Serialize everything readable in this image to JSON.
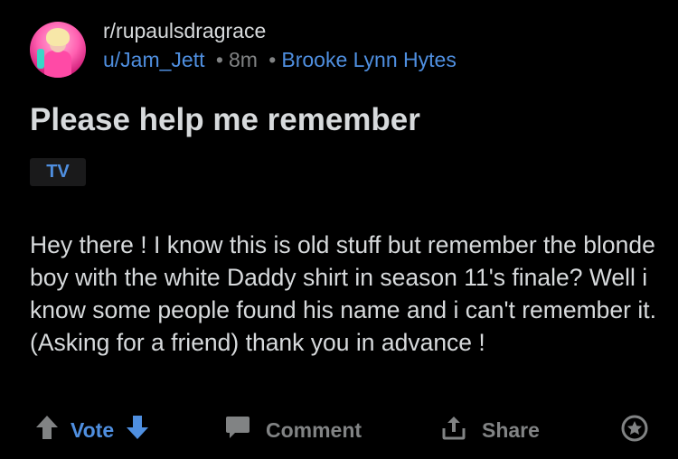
{
  "post": {
    "subreddit": "r/rupaulsdragrace",
    "author": "u/Jam_Jett",
    "separator": "•",
    "age": "8m",
    "user_flair": "Brooke Lynn Hytes",
    "title": "Please help me remember",
    "post_flair": "TV",
    "body": "Hey there ! I know this is old stuff but remember the blonde boy with the white Daddy shirt in season 11's finale? Well i know some people found his name and i can't remember it. (Asking for a friend) thank you in advance !"
  },
  "actions": {
    "vote_label": "Vote",
    "comment_label": "Comment",
    "share_label": "Share"
  },
  "colors": {
    "background": "#000000",
    "text": "#d7dadc",
    "muted": "#818384",
    "accent": "#4f8fe0"
  },
  "icons": {
    "upvote": "arrow-up-icon",
    "downvote": "arrow-down-icon",
    "comment": "speech-bubble-icon",
    "share": "share-icon",
    "award": "award-icon"
  }
}
